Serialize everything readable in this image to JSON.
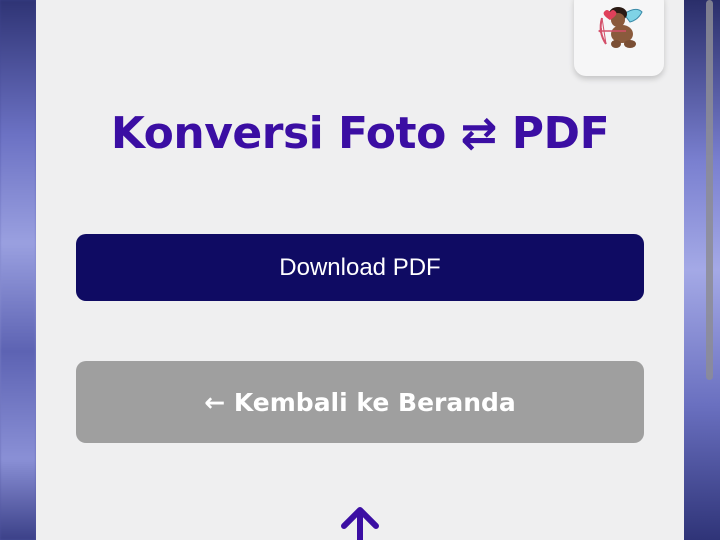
{
  "page": {
    "title": "Konversi Foto ⇄ PDF"
  },
  "buttons": {
    "download_label": "Download PDF",
    "back_label": "← Kembali ke Beranda"
  },
  "icons": {
    "mascot": "cupid-mascot-icon",
    "scroll_top": "arrow-up-icon"
  },
  "colors": {
    "title": "#3b0ea3",
    "download_bg": "#0f0b63",
    "back_bg": "#9f9f9f",
    "card_bg": "#efeff0"
  }
}
